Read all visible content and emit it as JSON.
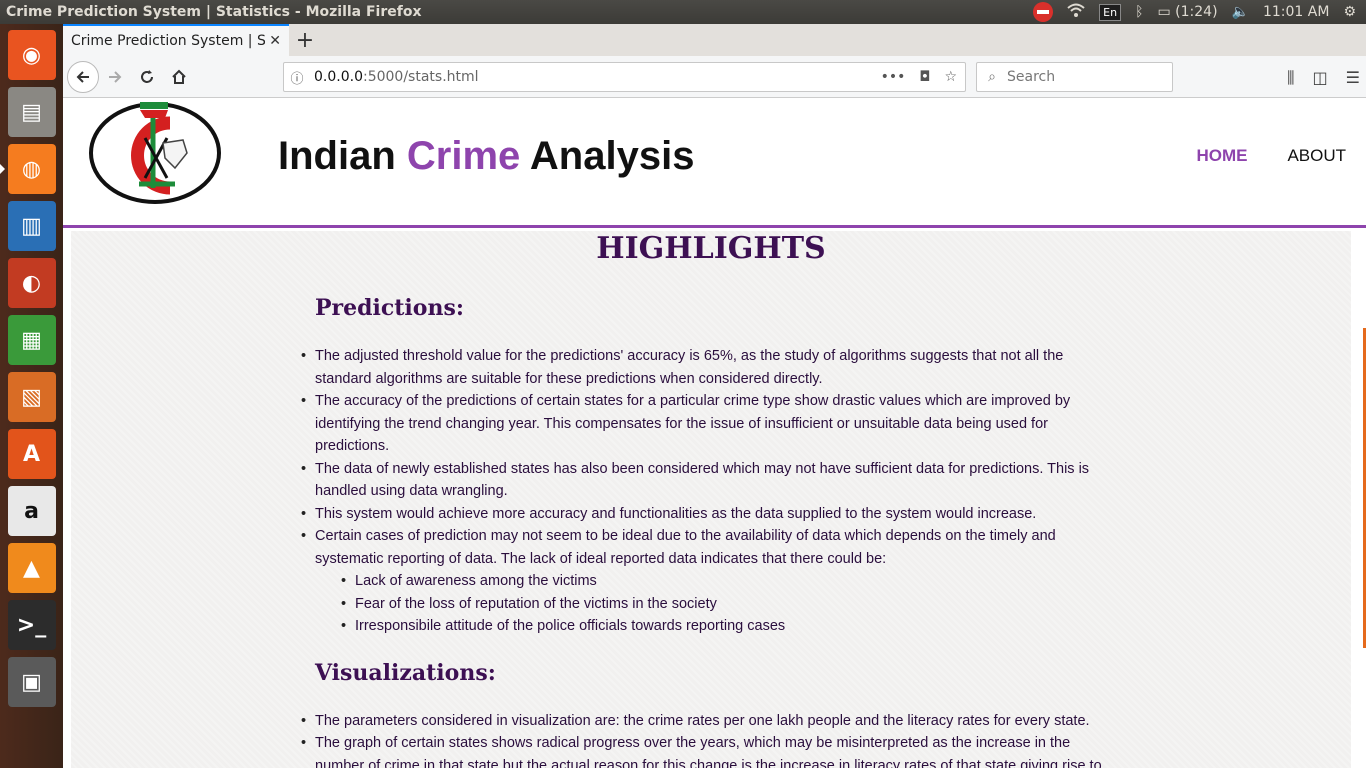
{
  "os_panel": {
    "window_title": "Crime Prediction System | Statistics - Mozilla Firefox",
    "keyboard": "En",
    "battery": "(1:24)",
    "clock": "11:01 AM"
  },
  "launcher": {
    "items": [
      {
        "name": "ubuntu-dash-icon",
        "glyph": "◉",
        "color": "#e95420"
      },
      {
        "name": "files-icon",
        "glyph": "▤",
        "color": "#8a8883"
      },
      {
        "name": "firefox-icon",
        "glyph": "◍",
        "color": "#f57c1f"
      },
      {
        "name": "writer-icon",
        "glyph": "▥",
        "color": "#2a6fb5"
      },
      {
        "name": "document-viewer-icon",
        "glyph": "◐",
        "color": "#c23b22"
      },
      {
        "name": "calc-icon",
        "glyph": "▦",
        "color": "#3a9a3a"
      },
      {
        "name": "impress-icon",
        "glyph": "▧",
        "color": "#d96c25"
      },
      {
        "name": "software-center-icon",
        "glyph": "A",
        "color": "#e2541b"
      },
      {
        "name": "amazon-icon",
        "glyph": "a",
        "color": "#e8e8e8"
      },
      {
        "name": "vlc-icon",
        "glyph": "▲",
        "color": "#f08a1c"
      },
      {
        "name": "terminal-icon",
        "glyph": ">_",
        "color": "#2c2c2c"
      },
      {
        "name": "workspaces-icon",
        "glyph": "▣",
        "color": "#5a5a5a"
      }
    ]
  },
  "browser": {
    "tab_title": "Crime Prediction System | Statistics",
    "tab_close": "✕",
    "new_tab": "+",
    "url_host": "0.0.0.0",
    "url_path": ":5000/stats.html",
    "search_placeholder": "Search"
  },
  "site": {
    "title_part1": "Indian ",
    "title_accent": "Crime",
    "title_part2": " Analysis",
    "nav_home": "HOME",
    "nav_about": "ABOUT"
  },
  "content": {
    "highlights": "HIGHLIGHTS",
    "predictions_title": "Predictions:",
    "predictions": [
      "The adjusted threshold value for the predictions' accuracy is 65%, as the study of algorithms suggests that not all the standard algorithms are suitable for these predictions when considered directly.",
      "The accuracy of the predictions of certain states for a particular crime type show drastic values which are improved by identifying the trend changing year. This compensates for the issue of insufficient or unsuitable data being used for predictions.",
      "The data of newly established states has also been considered which may not have sufficient data for predictions. This is handled using data wrangling.",
      "This system would achieve more accuracy and functionalities as the data supplied to the system would increase.",
      "Certain cases of prediction may not seem to be ideal due to the availability of data which depends on the timely and systematic reporting of data. The lack of ideal reported data indicates that there could be:"
    ],
    "prediction_subpoints": [
      "Lack of awareness among the victims",
      "Fear of the loss of reputation of the victims in the society",
      "Irresponsibile attitude of the police officials towards reporting cases"
    ],
    "visualizations_title": "Visualizations:",
    "visualizations": [
      "The parameters considered in visualization are: the crime rates per one lakh people and the literacy rates for every state.",
      "The graph of certain states shows radical progress over the years, which may be misinterpreted as the increase in the number of crime in that state but the actual reason for this change is the increase in literacy rates of that state giving rise to"
    ]
  }
}
